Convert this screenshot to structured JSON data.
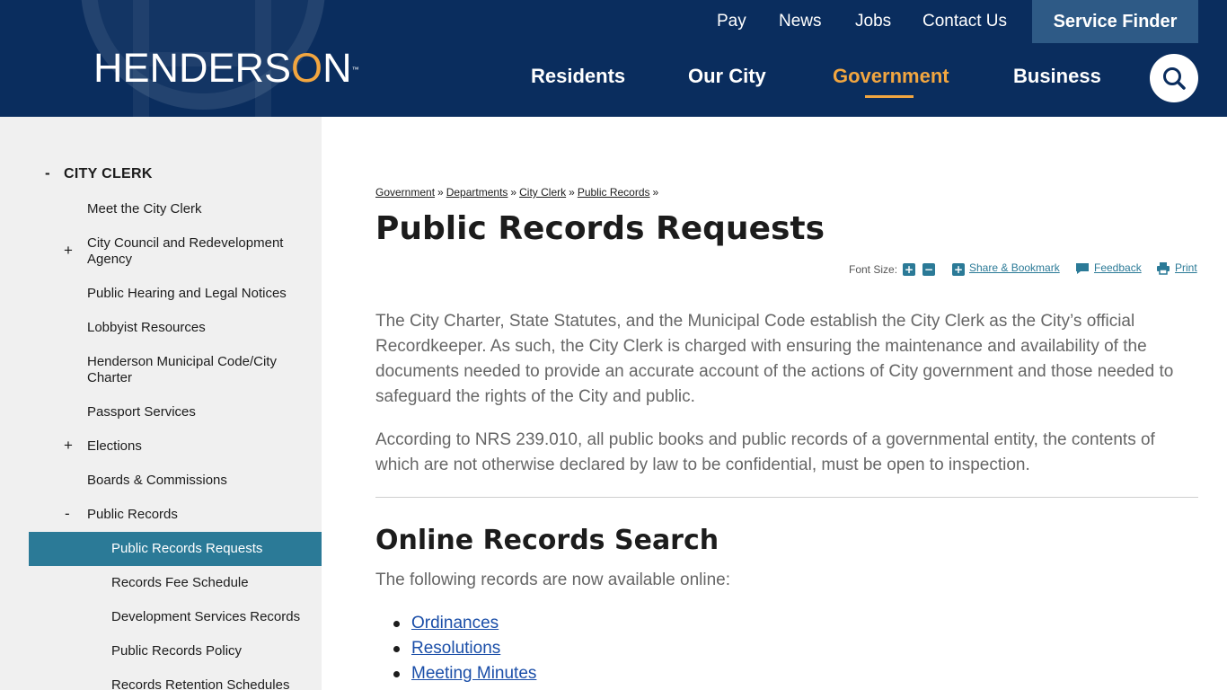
{
  "header": {
    "logo_text": "HENDERS",
    "logo_o": "O",
    "logo_end": "N",
    "logo_tm": "™",
    "utility_nav": {
      "pay": "Pay",
      "news": "News",
      "jobs": "Jobs",
      "contact": "Contact Us"
    },
    "service_finder": "Service Finder",
    "main_nav": {
      "residents": "Residents",
      "our_city": "Our City",
      "government": "Government",
      "business": "Business"
    },
    "colors": {
      "background": "#0a2d5e",
      "accent": "#f2a640",
      "service_finder_bg": "#2e5a86"
    }
  },
  "sidebar": {
    "heading_toggle": "-",
    "heading": "CITY CLERK",
    "items": [
      {
        "label": "Meet the City Clerk",
        "toggle": ""
      },
      {
        "label": "City Council and Redevelopment Agency",
        "toggle": "+"
      },
      {
        "label": "Public Hearing and Legal Notices",
        "toggle": ""
      },
      {
        "label": "Lobbyist Resources",
        "toggle": ""
      },
      {
        "label": "Henderson Municipal Code/City Charter",
        "toggle": ""
      },
      {
        "label": "Passport Services",
        "toggle": ""
      },
      {
        "label": "Elections",
        "toggle": "+"
      },
      {
        "label": "Boards & Commissions",
        "toggle": ""
      },
      {
        "label": "Public Records",
        "toggle": "-"
      }
    ],
    "subitems": [
      {
        "label": "Public Records Requests",
        "active": true
      },
      {
        "label": "Records Fee Schedule",
        "active": false
      },
      {
        "label": "Development Services Records",
        "active": false
      },
      {
        "label": "Public Records Policy",
        "active": false
      },
      {
        "label": "Records Retention Schedules",
        "active": false
      }
    ],
    "colors": {
      "background": "#f0f0f0",
      "active": "#2b7a97"
    }
  },
  "breadcrumb": {
    "items": [
      "Government",
      "Departments",
      "City Clerk",
      "Public Records"
    ],
    "separator": "»"
  },
  "page": {
    "title": "Public Records Requests",
    "tools": {
      "font_size_label": "Font Size:",
      "increase": "+",
      "decrease": "−",
      "share_icon_glyph": "+",
      "share": "Share & Bookmark",
      "feedback": "Feedback",
      "print": "Print"
    },
    "paragraphs": [
      "The City Charter, State Statutes, and the Municipal Code establish the City Clerk as the City’s official Recordkeeper. As such, the City Clerk is charged with ensuring the maintenance and availability of the documents needed to provide an accurate account of the actions of City government and those needed to safeguard the rights of the City and public.",
      "According to NRS 239.010, all public books and public records of a governmental entity, the contents of which are not otherwise declared by law to be confidential, must be open to inspection."
    ],
    "section_title": "Online Records Search",
    "section_intro": "The following records are now available online:",
    "records_links": [
      "Ordinances",
      "Resolutions",
      "Meeting Minutes"
    ]
  }
}
